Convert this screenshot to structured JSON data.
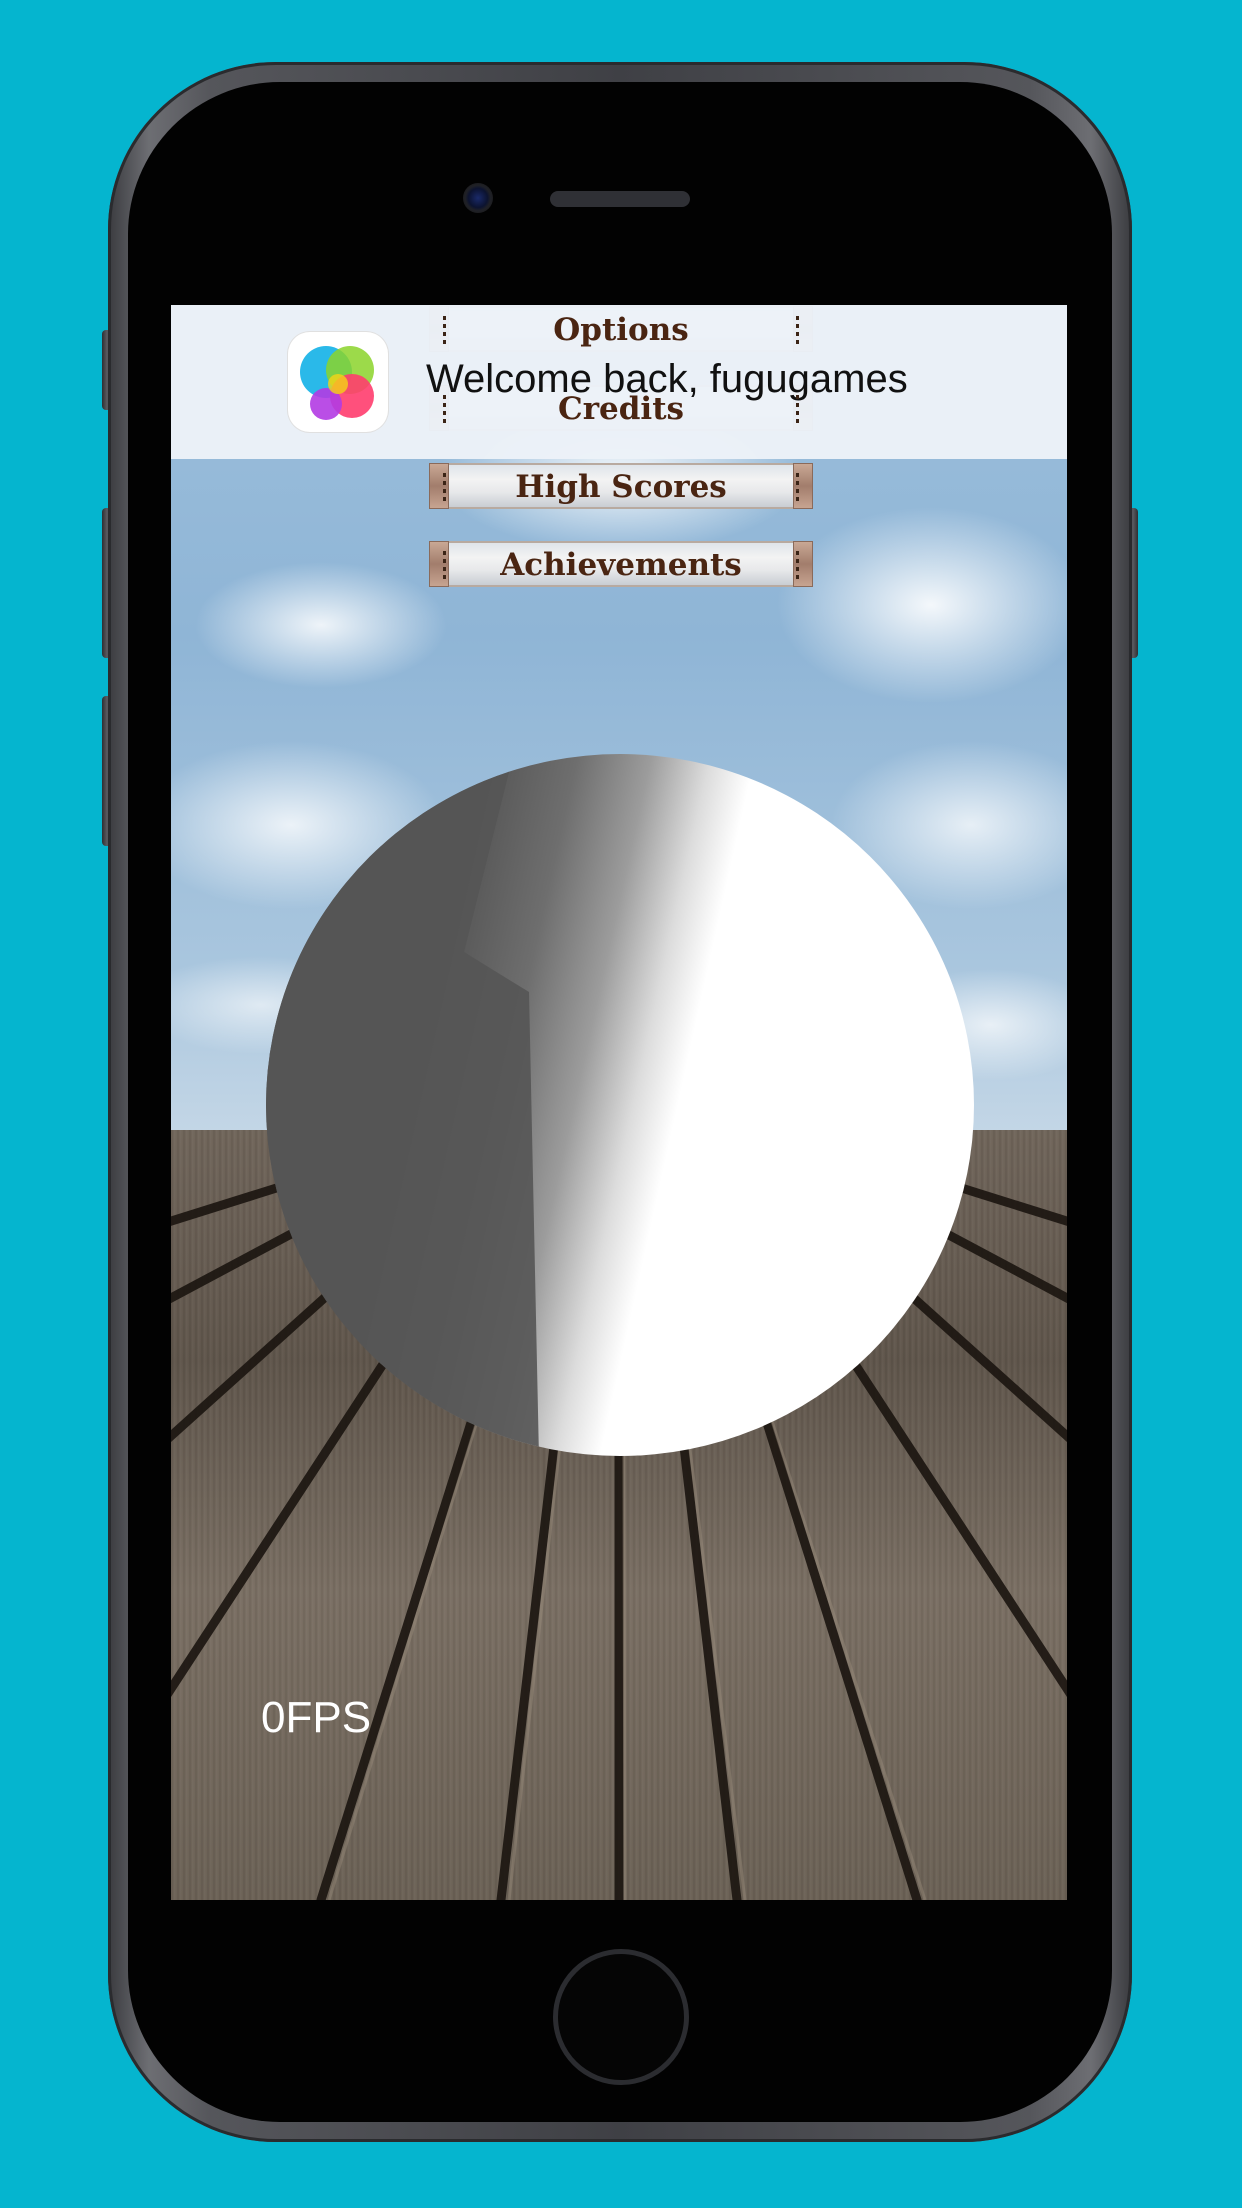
{
  "game_center": {
    "welcome_text": "Welcome back, fugugames",
    "icon": "game-center-icon"
  },
  "menu": {
    "items": [
      {
        "label": "Options"
      },
      {
        "label": "Credits"
      },
      {
        "label": "High Scores"
      },
      {
        "label": "Achievements"
      }
    ]
  },
  "hud": {
    "fps_text": "0FPS"
  },
  "colors": {
    "background": "#05b5cf",
    "menu_text": "#4a2512"
  }
}
